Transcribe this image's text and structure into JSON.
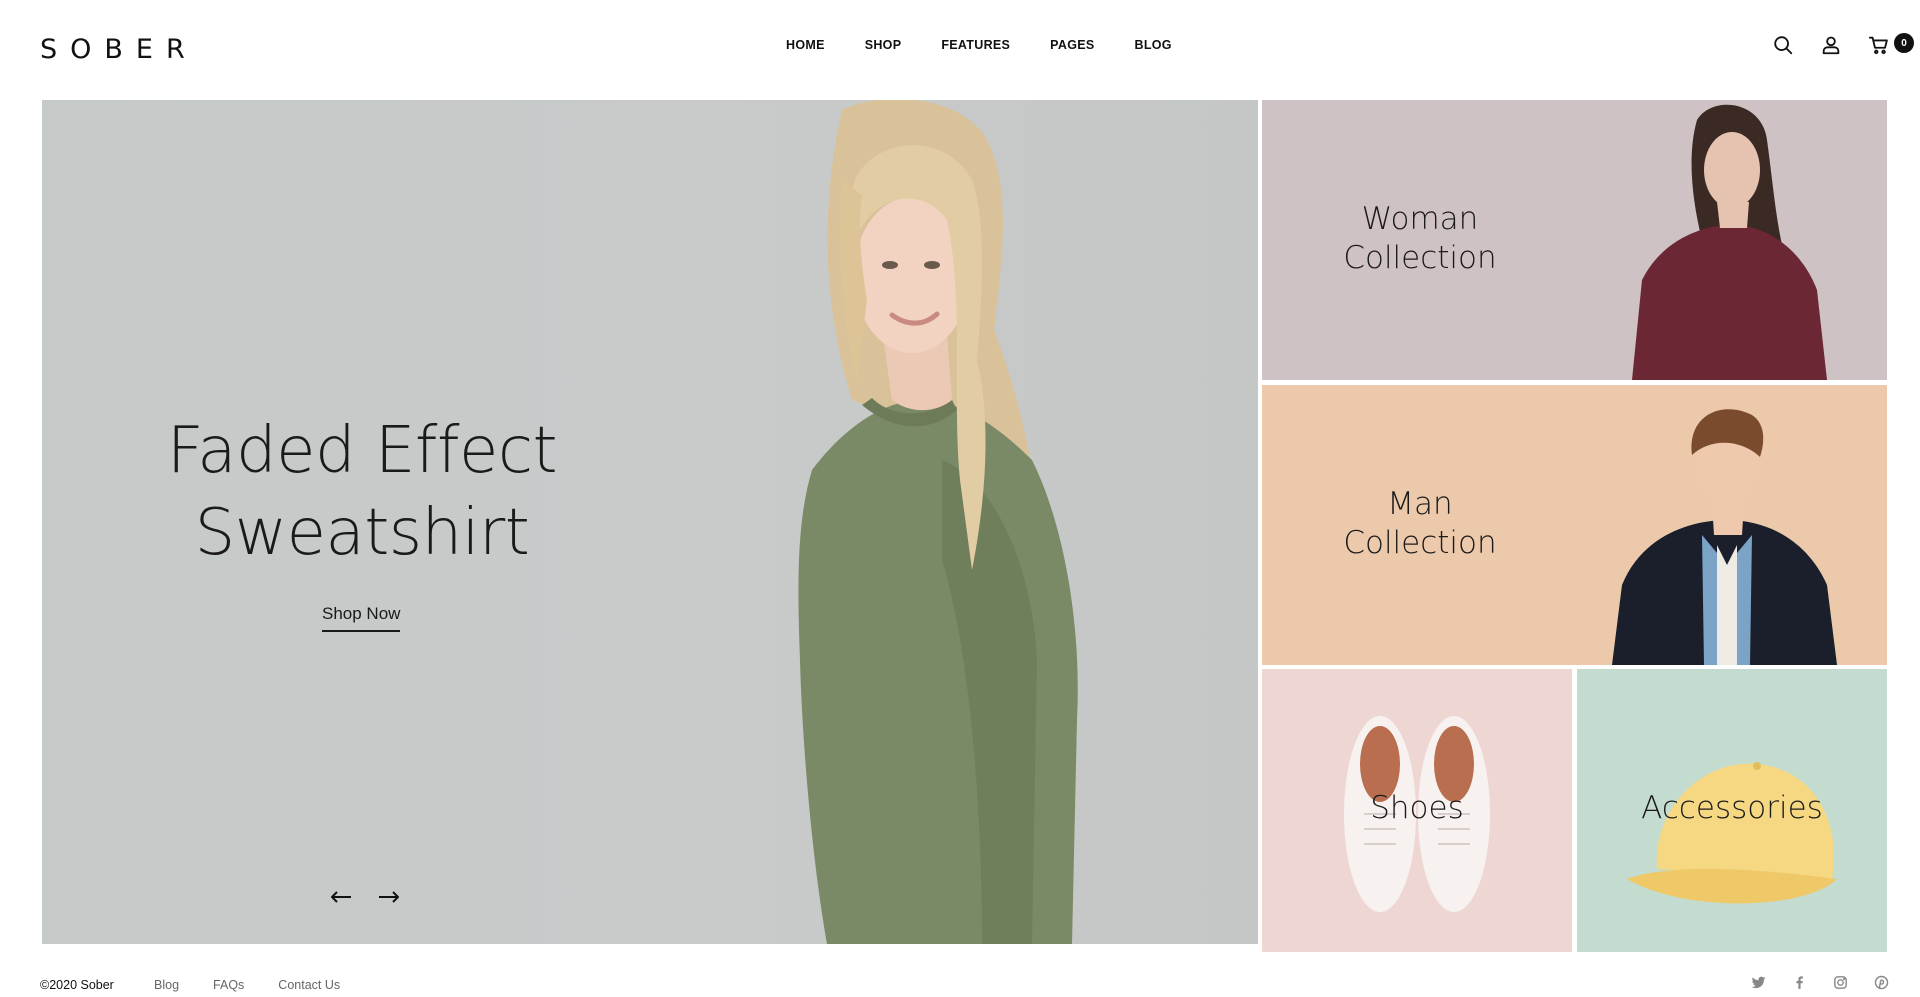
{
  "header": {
    "logo": "SOBER",
    "nav": [
      {
        "label": "HOME"
      },
      {
        "label": "SHOP"
      },
      {
        "label": "FEATURES"
      },
      {
        "label": "PAGES"
      },
      {
        "label": "BLOG"
      }
    ],
    "icons": [
      "search-icon",
      "user-icon",
      "cart-icon"
    ],
    "cart_count": "0"
  },
  "hero": {
    "title_line1": "Faded Effect",
    "title_line2": "Sweatshirt",
    "cta_label": "Shop Now",
    "background_color": "#c6c9c8",
    "sweatshirt_color": "#7b8a66"
  },
  "collections": {
    "woman": {
      "line1": "Woman",
      "line2": "Collection",
      "bg": "#cfc2c4"
    },
    "man": {
      "line1": "Man",
      "line2": "Collection",
      "bg": "#ecc9ab"
    },
    "shoes": {
      "label": "Shoes",
      "bg": "#eed6d3"
    },
    "accessories": {
      "label": "Accessories",
      "bg": "#c4dccf"
    }
  },
  "footer": {
    "copyright": "©2020 Sober",
    "links": [
      "Blog",
      "FAQs",
      "Contact Us"
    ],
    "social": [
      "twitter-icon",
      "facebook-icon",
      "instagram-icon",
      "pinterest-icon"
    ]
  }
}
